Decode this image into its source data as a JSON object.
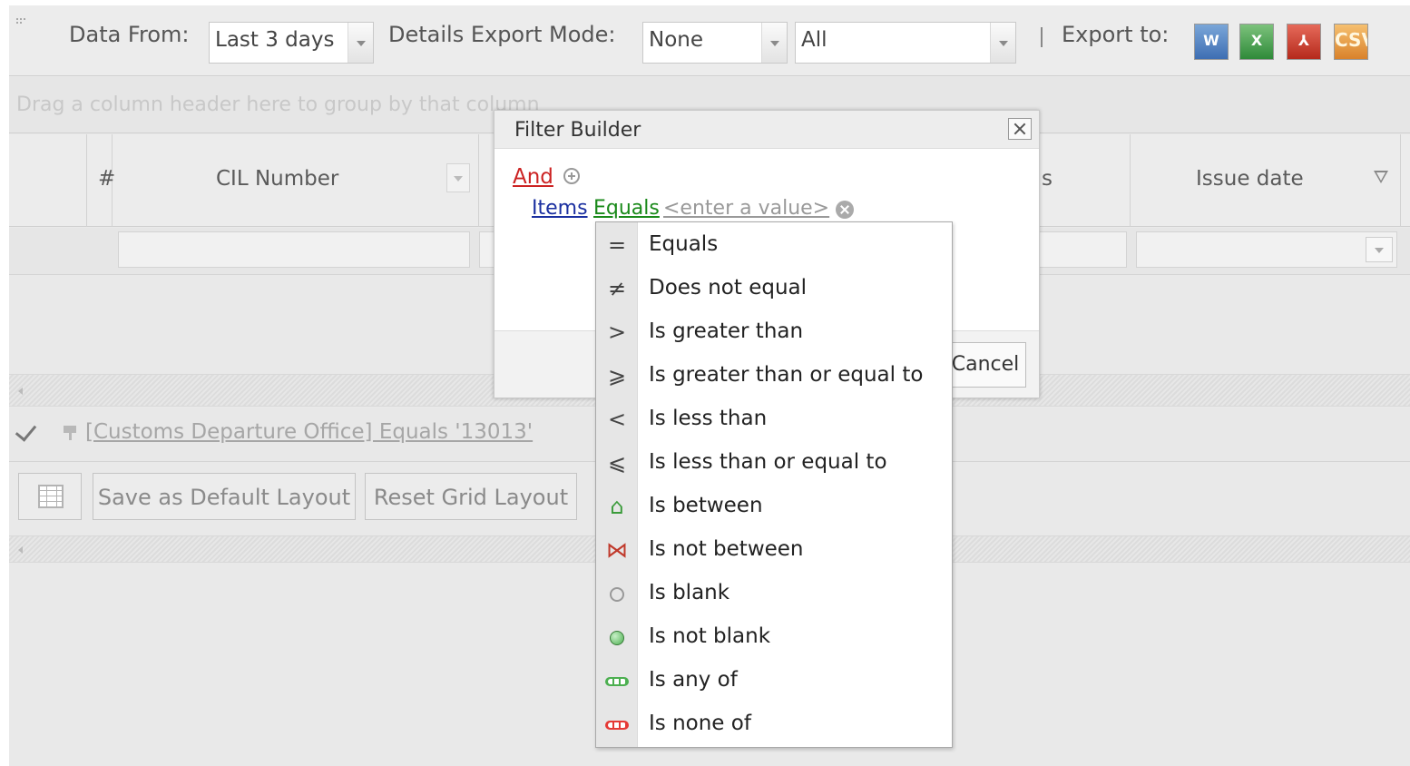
{
  "toolbar": {
    "data_from_label": "Data From:",
    "data_from_value": "Last 3 days",
    "export_mode_label": "Details Export Mode:",
    "export_mode_value": "None",
    "scope_value": "All",
    "export_to_label": "Export to:",
    "export_buttons": [
      {
        "name": "word-export-icon",
        "glyph": "W"
      },
      {
        "name": "excel-export-icon",
        "glyph": "X"
      },
      {
        "name": "pdf-export-icon",
        "glyph": "⅄"
      },
      {
        "name": "csv-export-icon",
        "glyph": "CSV"
      }
    ]
  },
  "group_panel": {
    "hint": "Drag a column header here to group by that column"
  },
  "grid": {
    "columns": [
      {
        "label": "#"
      },
      {
        "label": "CIL Number"
      },
      {
        "label": "s"
      },
      {
        "label": "Issue date"
      }
    ]
  },
  "filter_bar": {
    "expression": "[Customs Departure Office] Equals '13013'"
  },
  "buttons": {
    "save_default": "Save as Default Layout",
    "reset_grid": "Reset Grid Layout"
  },
  "dialog": {
    "title": "Filter Builder",
    "group_operator": "And",
    "condition": {
      "field": "Items",
      "operator": "Equals",
      "value_placeholder": "<enter a value>"
    },
    "cancel_label": "Cancel"
  },
  "operators": [
    {
      "label": "Equals",
      "icon": "equals-icon",
      "glyph": "="
    },
    {
      "label": "Does not equal",
      "icon": "not-equal-icon",
      "glyph": "≠"
    },
    {
      "label": "Is greater than",
      "icon": "greater-than-icon",
      "glyph": ">"
    },
    {
      "label": "Is greater than or equal to",
      "icon": "greater-or-equal-icon",
      "glyph": "⩾"
    },
    {
      "label": "Is less than",
      "icon": "less-than-icon",
      "glyph": "<"
    },
    {
      "label": "Is less than or equal to",
      "icon": "less-or-equal-icon",
      "glyph": "⩽"
    },
    {
      "label": "Is between",
      "icon": "between-icon",
      "glyph": "⌂",
      "color": "#3a9b3a"
    },
    {
      "label": "Is not between",
      "icon": "not-between-icon",
      "glyph": "⋈",
      "color": "#c0392b"
    },
    {
      "label": "Is blank",
      "icon": "blank-circle-icon",
      "color": "#999999"
    },
    {
      "label": "Is not blank",
      "icon": "filled-circle-icon",
      "color": "#4caf50"
    },
    {
      "label": "Is any of",
      "icon": "any-of-icon",
      "color": "#4caf50"
    },
    {
      "label": "Is none of",
      "icon": "none-of-icon",
      "color": "#e53935"
    }
  ]
}
